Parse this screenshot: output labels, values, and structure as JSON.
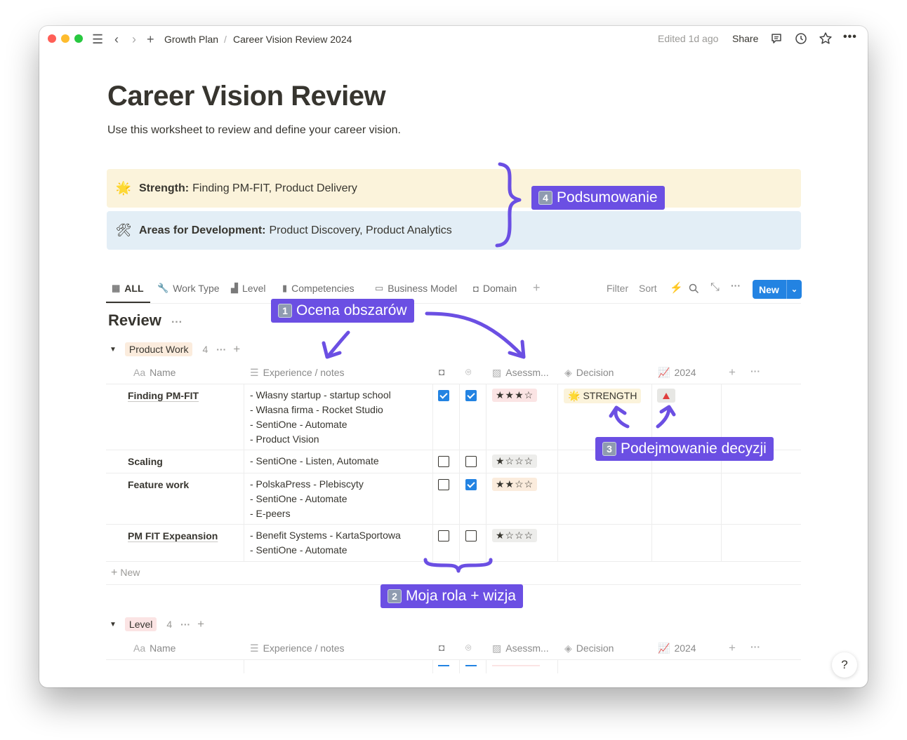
{
  "titlebar": {
    "breadcrumb": [
      "Growth Plan",
      "/",
      "Career Vision Review 2024"
    ],
    "edited": "Edited 1d ago",
    "share": "Share"
  },
  "page": {
    "title": "Career Vision Review",
    "description": "Use this worksheet to review and define your career vision."
  },
  "callouts": {
    "strength": {
      "label": "Strength:",
      "text": "Finding PM-FIT, Product Delivery",
      "color": "#fbf3db"
    },
    "development": {
      "label": "Areas for Development:",
      "text": "Product Discovery, Product Analytics",
      "color": "#e3eef6"
    }
  },
  "tabs": [
    "ALL",
    "Work Type",
    "Level",
    "Competencies",
    "Business Model",
    "Domain"
  ],
  "toolbar": {
    "filter": "Filter",
    "sort": "Sort",
    "new": "New"
  },
  "review": {
    "title": "Review"
  },
  "columns": {
    "name": "Name",
    "notes": "Experience / notes",
    "assessment": "Asessm...",
    "decision": "Decision",
    "year": "2024"
  },
  "groups": [
    {
      "name": "Product Work",
      "count": "4",
      "color": "#fbecdd",
      "rows": [
        {
          "name": "Finding PM-FIT",
          "notes": [
            "- Własny startup - startup school",
            "- Własna firma - Rocket Studio",
            "- SentiOne - Automate",
            "- Product Vision"
          ],
          "cb1": true,
          "cb2": true,
          "stars": "★★★☆",
          "decision": "STRENGTH"
        },
        {
          "name": "Scaling",
          "notes": [
            "- SentiOne - Listen, Automate"
          ],
          "cb1": false,
          "cb2": false,
          "stars": "★☆☆☆"
        },
        {
          "name": "Feature work",
          "notes": [
            "- PolskaPress - Plebiscyty",
            "- SentiOne - Automate",
            "- E-peers"
          ],
          "cb1": false,
          "cb2": true,
          "stars": "★★☆☆"
        },
        {
          "name": "PM FIT Expeansion",
          "notes": [
            "- Benefit Systems - KartaSportowa",
            "- SentiOne - Automate"
          ],
          "cb1": false,
          "cb2": false,
          "stars": "★☆☆☆"
        }
      ],
      "new_row": "New"
    },
    {
      "name": "Level",
      "count": "4",
      "color": "#fbe4e4"
    }
  ],
  "annotations": {
    "a1": {
      "num": "1",
      "text": "Ocena obszarów"
    },
    "a2": {
      "num": "2",
      "text": "Moja rola + wizja"
    },
    "a3": {
      "num": "3",
      "text": "Podejmowanie decyzji"
    },
    "a4": {
      "num": "4",
      "text": "Podsumowanie"
    }
  },
  "help": "?",
  "colors": {
    "accent": "#2383e2",
    "annotation": "#6b4fe3",
    "trend_up": "#e03e3e"
  }
}
